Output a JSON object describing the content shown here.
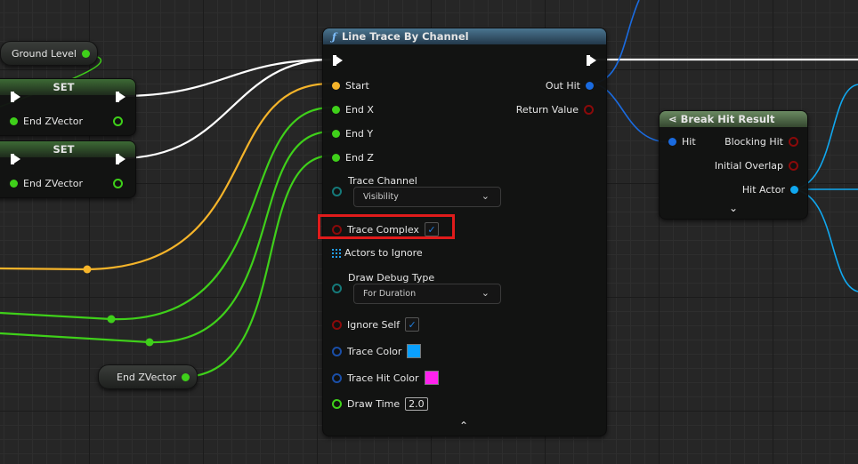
{
  "ground_level": {
    "label": "Ground Level"
  },
  "set_nodes": [
    {
      "title": "SET",
      "pin": "End ZVector"
    },
    {
      "title": "SET",
      "pin": "End ZVector"
    }
  ],
  "end_zvector_getter": {
    "label": "End ZVector"
  },
  "line_trace": {
    "icon": "function-icon",
    "title": "Line Trace By Channel",
    "inputs": {
      "start": "Start",
      "end_x": "End X",
      "end_y": "End Y",
      "end_z": "End Z",
      "trace_channel": "Trace Channel",
      "trace_channel_value": "Visibility",
      "trace_complex": "Trace Complex",
      "trace_complex_checked": true,
      "actors_to_ignore": "Actors to Ignore",
      "draw_debug_type": "Draw Debug Type",
      "draw_debug_type_value": "For Duration",
      "ignore_self": "Ignore Self",
      "ignore_self_checked": true,
      "trace_color": "Trace Color",
      "trace_color_value": "#0aa0ff",
      "trace_hit_color": "Trace Hit Color",
      "trace_hit_color_value": "#ff22ee",
      "draw_time": "Draw Time",
      "draw_time_value": "2.0"
    },
    "outputs": {
      "out_hit": "Out Hit",
      "return_value": "Return Value"
    }
  },
  "break_hit": {
    "icon": "break-struct-icon",
    "title": "Break Hit Result",
    "input": "Hit",
    "outputs": [
      "Blocking Hit",
      "Initial Overlap",
      "Hit Actor"
    ]
  },
  "highlight_color": "#e01b1b",
  "colors": {
    "exec": "#ffffff",
    "vector": "#f5b42a",
    "float": "#3fd01a",
    "struct": "#1a6be0",
    "object": "#10a8f0",
    "bool": "#8a0a0a",
    "header_function": "#3a5f7a",
    "header_break": "#4f6f4a"
  }
}
